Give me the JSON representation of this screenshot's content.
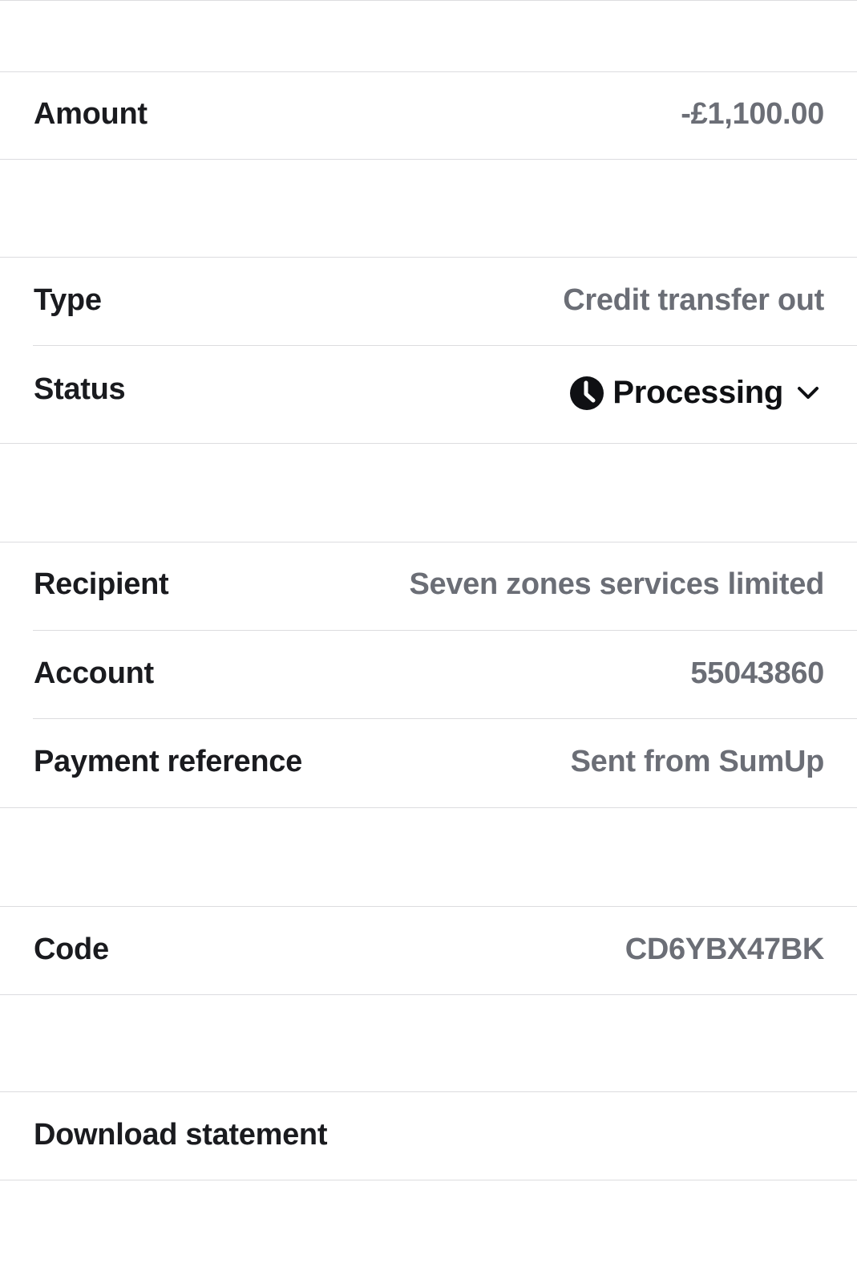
{
  "amount": {
    "label": "Amount",
    "value": "-£1,100.00"
  },
  "details": {
    "type": {
      "label": "Type",
      "value": "Credit transfer out"
    },
    "status": {
      "label": "Status",
      "value": "Processing",
      "icon": "clock-icon",
      "expand_icon": "chevron-down-icon"
    }
  },
  "recipient": {
    "recipient": {
      "label": "Recipient",
      "value": "Seven zones services limited"
    },
    "account": {
      "label": "Account",
      "value": "55043860"
    },
    "reference": {
      "label": "Payment reference",
      "value": "Sent from SumUp"
    }
  },
  "code": {
    "label": "Code",
    "value": "CD6YBX47BK"
  },
  "actions": {
    "download_label": "Download statement"
  },
  "colors": {
    "label": "#1a1b1f",
    "value": "#6b6e76",
    "status": "#0f1013",
    "divider": "#dcdcdf"
  }
}
